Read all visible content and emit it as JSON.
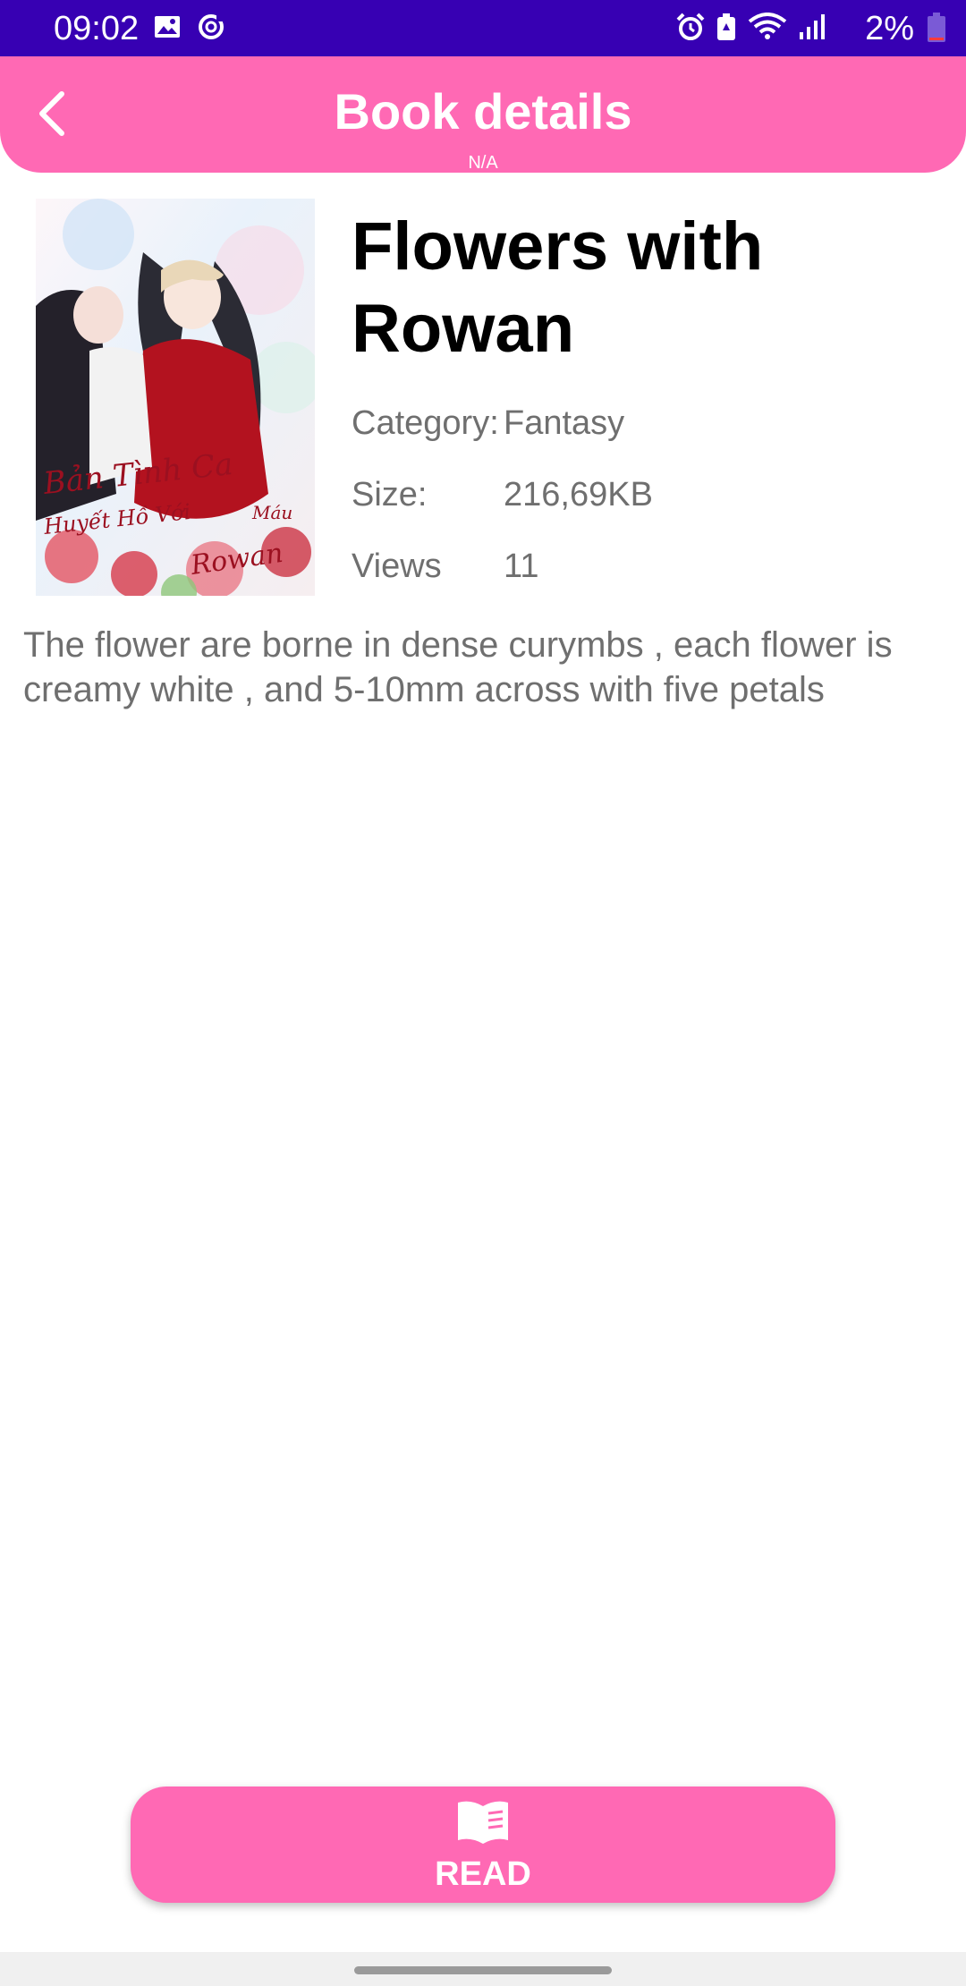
{
  "status_bar": {
    "time": "09:02",
    "battery": "2%",
    "left_icons": [
      "gallery-icon",
      "sync-icon"
    ],
    "right_icons": [
      "alarm-icon",
      "battery-saver-icon",
      "wifi-icon",
      "signal-icon"
    ]
  },
  "header": {
    "title": "Book details",
    "subtitle": "N/A",
    "back_icon": "chevron-left-icon",
    "background": "#ff69b4"
  },
  "book": {
    "title": "Flowers with Rowan",
    "cover_text": {
      "line1": "Bản Tình Ca",
      "line2": "Huyết Hồ Với",
      "line3": "Máu",
      "line4": "Rowan"
    },
    "meta": [
      {
        "label": "Category:",
        "value": "Fantasy"
      },
      {
        "label": "Size:",
        "value": "216,69KB"
      },
      {
        "label": "Views",
        "value": "11"
      }
    ],
    "description": "The flower are borne in dense curymbs , each flower is creamy white , and 5-10mm across with five petals"
  },
  "read_button": {
    "label": "READ",
    "icon": "open-book-icon",
    "background": "#ff69b4"
  },
  "colors": {
    "status_bar": "#3700b3",
    "accent": "#ff69b4",
    "meta_text": "#6f6f6f"
  }
}
